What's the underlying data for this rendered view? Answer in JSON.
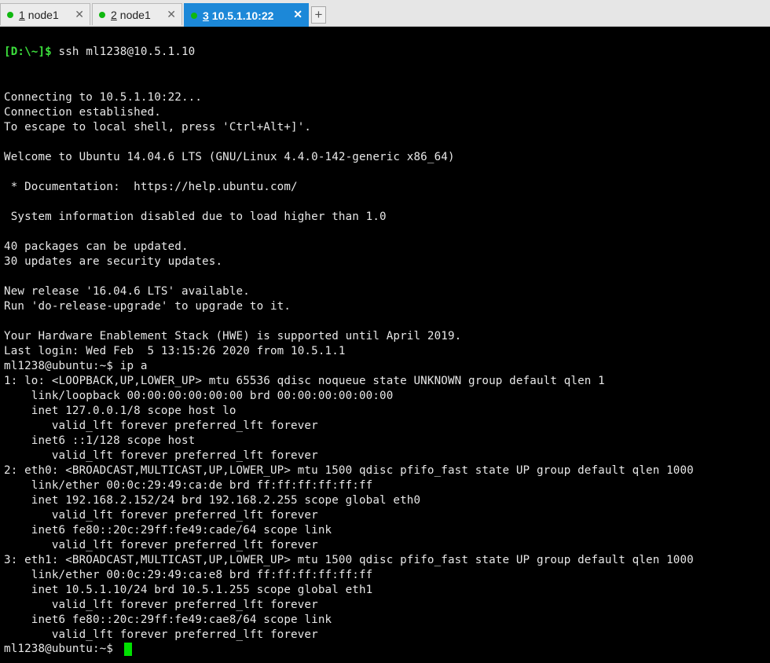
{
  "tabs": [
    {
      "num": "1",
      "title": "node1",
      "close": "✕"
    },
    {
      "num": "2",
      "title": "node1",
      "close": "✕"
    },
    {
      "num": "3",
      "title": "10.5.1.10:22",
      "close": "✕"
    }
  ],
  "new_tab_label": "+",
  "terminal": {
    "prompt_local": "[D:\\~]$",
    "command_ssh": "ssh ml1238@10.5.1.10",
    "lines": [
      "Connecting to 10.5.1.10:22...",
      "Connection established.",
      "To escape to local shell, press 'Ctrl+Alt+]'.",
      "",
      "Welcome to Ubuntu 14.04.6 LTS (GNU/Linux 4.4.0-142-generic x86_64)",
      "",
      " * Documentation:  https://help.ubuntu.com/",
      "",
      " System information disabled due to load higher than 1.0",
      "",
      "40 packages can be updated.",
      "30 updates are security updates.",
      "",
      "New release '16.04.6 LTS' available.",
      "Run 'do-release-upgrade' to upgrade to it.",
      "",
      "Your Hardware Enablement Stack (HWE) is supported until April 2019.",
      "Last login: Wed Feb  5 13:15:26 2020 from 10.5.1.1",
      "ml1238@ubuntu:~$ ip a",
      "1: lo: <LOOPBACK,UP,LOWER_UP> mtu 65536 qdisc noqueue state UNKNOWN group default qlen 1",
      "    link/loopback 00:00:00:00:00:00 brd 00:00:00:00:00:00",
      "    inet 127.0.0.1/8 scope host lo",
      "       valid_lft forever preferred_lft forever",
      "    inet6 ::1/128 scope host",
      "       valid_lft forever preferred_lft forever",
      "2: eth0: <BROADCAST,MULTICAST,UP,LOWER_UP> mtu 1500 qdisc pfifo_fast state UP group default qlen 1000",
      "    link/ether 00:0c:29:49:ca:de brd ff:ff:ff:ff:ff:ff",
      "    inet 192.168.2.152/24 brd 192.168.2.255 scope global eth0",
      "       valid_lft forever preferred_lft forever",
      "    inet6 fe80::20c:29ff:fe49:cade/64 scope link",
      "       valid_lft forever preferred_lft forever",
      "3: eth1: <BROADCAST,MULTICAST,UP,LOWER_UP> mtu 1500 qdisc pfifo_fast state UP group default qlen 1000",
      "    link/ether 00:0c:29:49:ca:e8 brd ff:ff:ff:ff:ff:ff",
      "    inet 10.5.1.10/24 brd 10.5.1.255 scope global eth1",
      "       valid_lft forever preferred_lft forever",
      "    inet6 fe80::20c:29ff:fe49:cae8/64 scope link",
      "       valid_lft forever preferred_lft forever"
    ],
    "final_prompt": "ml1238@ubuntu:~$"
  },
  "colors": {
    "prompt": "#3ce03c",
    "cursor": "#00e000",
    "active_tab": "#1c88d8",
    "status_dot": "#10b810"
  }
}
